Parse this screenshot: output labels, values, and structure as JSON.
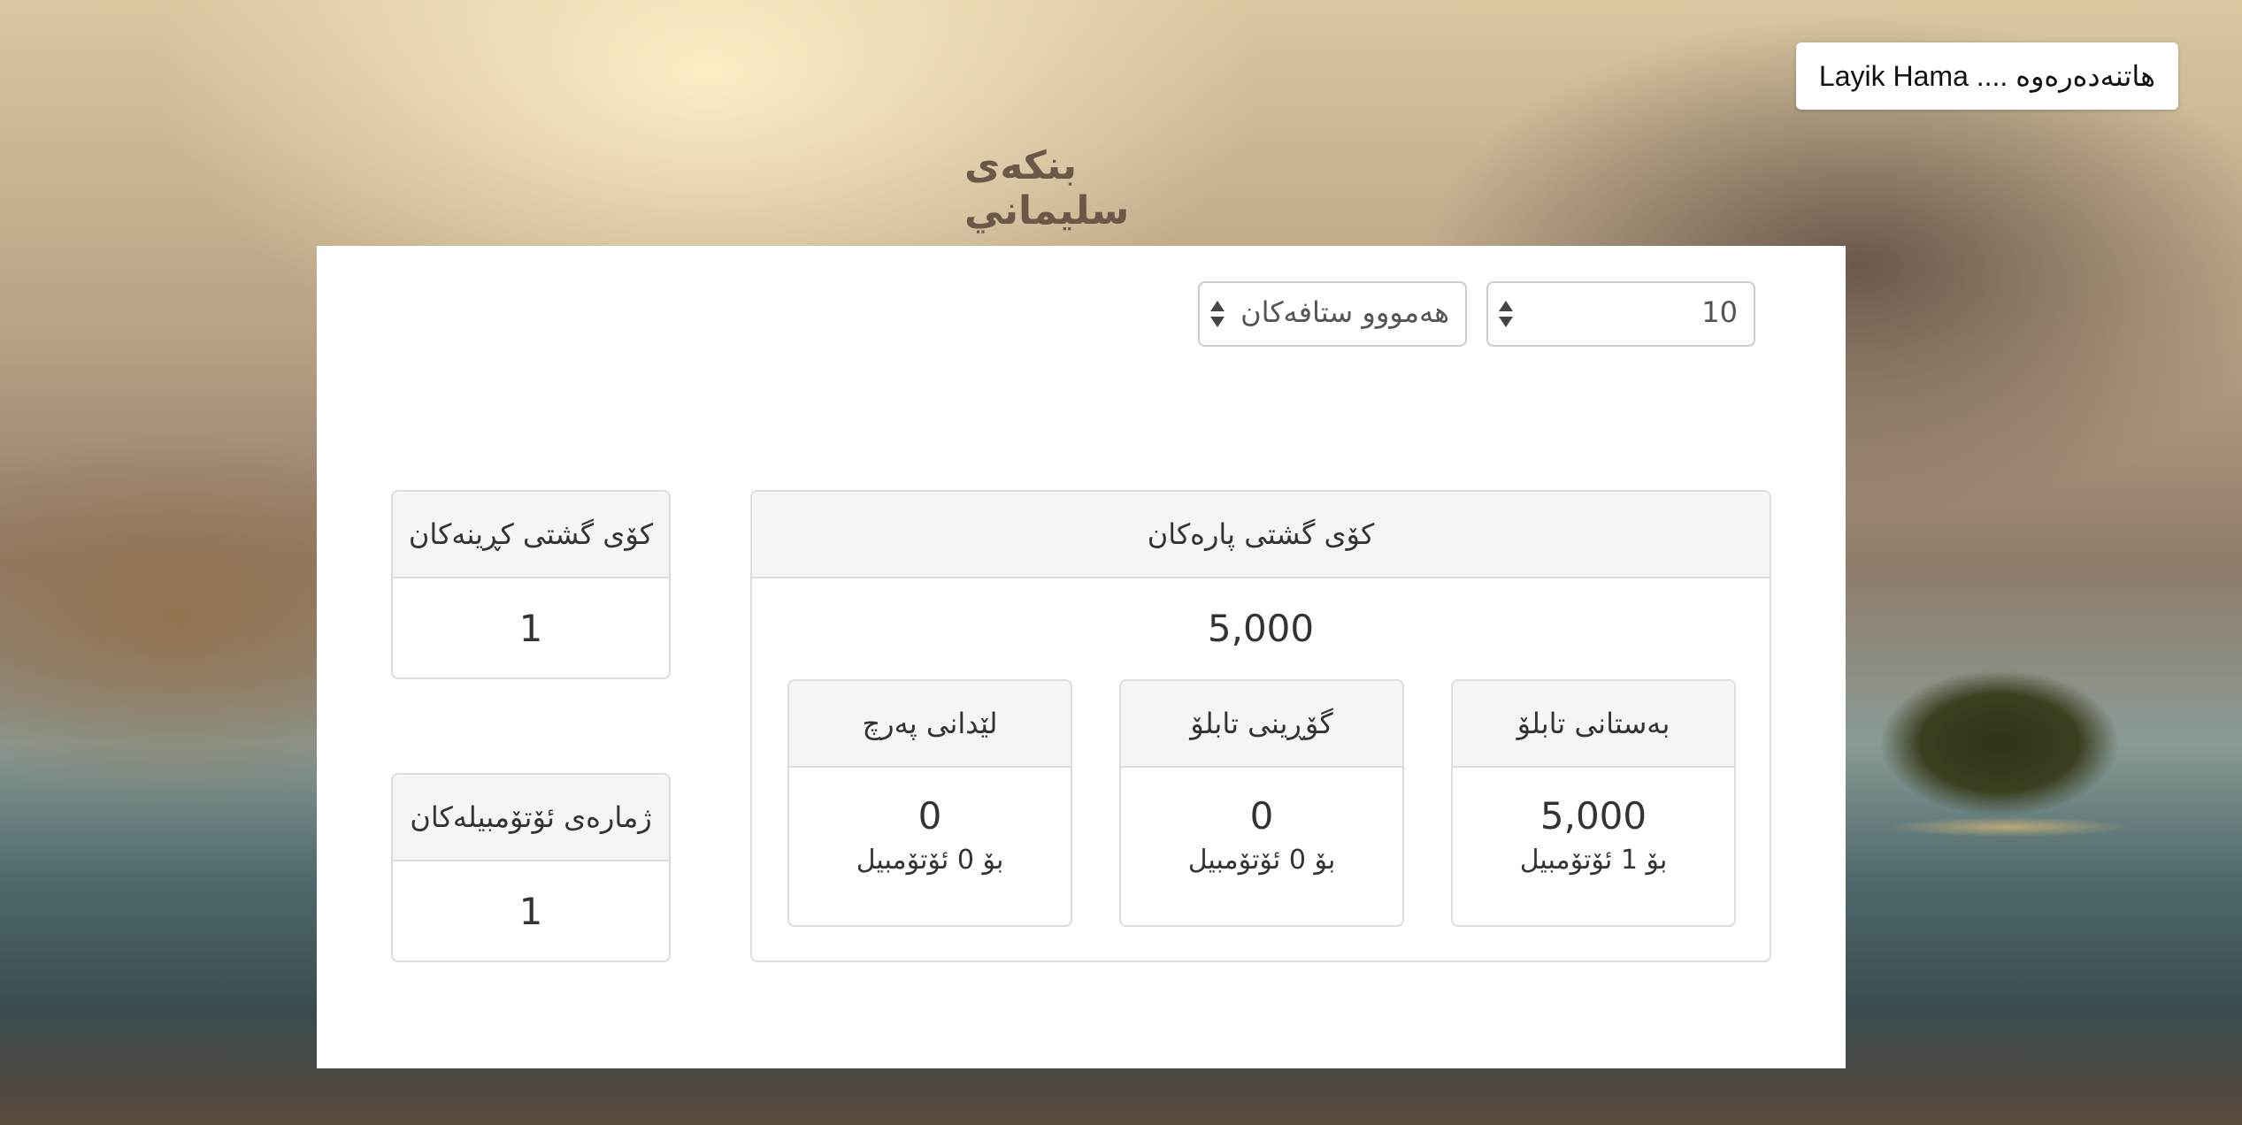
{
  "header": {
    "welcome": "هاتنەدەرەوە .... Layik Hama",
    "bank_title": "بنکەی سليماني"
  },
  "filters": {
    "page_size": "10",
    "staff_filter": "هەمووو ستافەکان"
  },
  "totals": {
    "money": {
      "title": "کۆی گشتی پارەکان",
      "value": "5,000"
    },
    "purchases": {
      "title": "کۆی گشتی کڕینەکان",
      "value": "1"
    },
    "cars": {
      "title": "ژمارەی ئۆتۆمبیلەکان",
      "value": "1"
    }
  },
  "breakdown": [
    {
      "title": "بەستانی تابلۆ",
      "value": "5,000",
      "sub": "بۆ 1 ئۆتۆمبیل"
    },
    {
      "title": "گۆڕینی تابلۆ",
      "value": "0",
      "sub": "بۆ 0 ئۆتۆمبیل"
    },
    {
      "title": "لێدانی پەرچ",
      "value": "0",
      "sub": "بۆ 0 ئۆتۆمبیل"
    }
  ]
}
